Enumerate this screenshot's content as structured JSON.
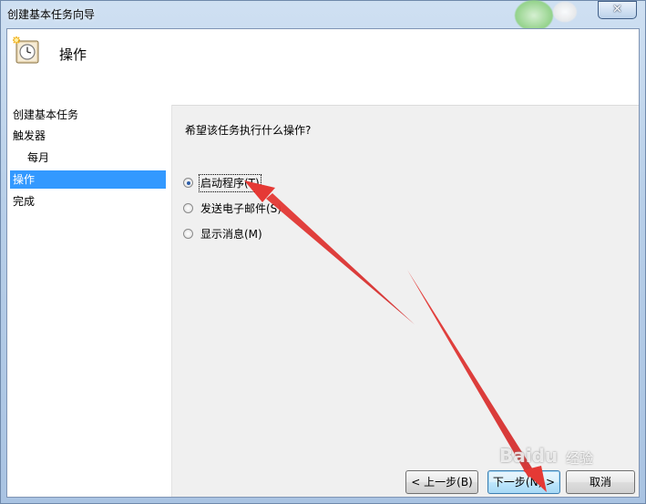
{
  "window": {
    "title": "创建基本任务向导",
    "close_glyph": "✕"
  },
  "header": {
    "title": "操作",
    "icon": "task-clock-icon"
  },
  "steps": [
    {
      "label": "创建基本任务",
      "sub": false,
      "active": false
    },
    {
      "label": "触发器",
      "sub": false,
      "active": false
    },
    {
      "label": "每月",
      "sub": true,
      "active": false
    },
    {
      "label": "操作",
      "sub": false,
      "active": true
    },
    {
      "label": "完成",
      "sub": false,
      "active": false
    }
  ],
  "content": {
    "question": "希望该任务执行什么操作?",
    "options": [
      {
        "label": "启动程序(T)",
        "checked": true
      },
      {
        "label": "发送电子邮件(S)",
        "checked": false
      },
      {
        "label": "显示消息(M)",
        "checked": false
      }
    ]
  },
  "buttons": {
    "back": "< 上一步(B)",
    "next": "下一步(N) >",
    "cancel": "取消"
  },
  "watermark": {
    "brand": "Baidu",
    "suffix": "经验"
  },
  "colors": {
    "selection": "#3399ff",
    "annotation_arrow": "#e53935"
  }
}
